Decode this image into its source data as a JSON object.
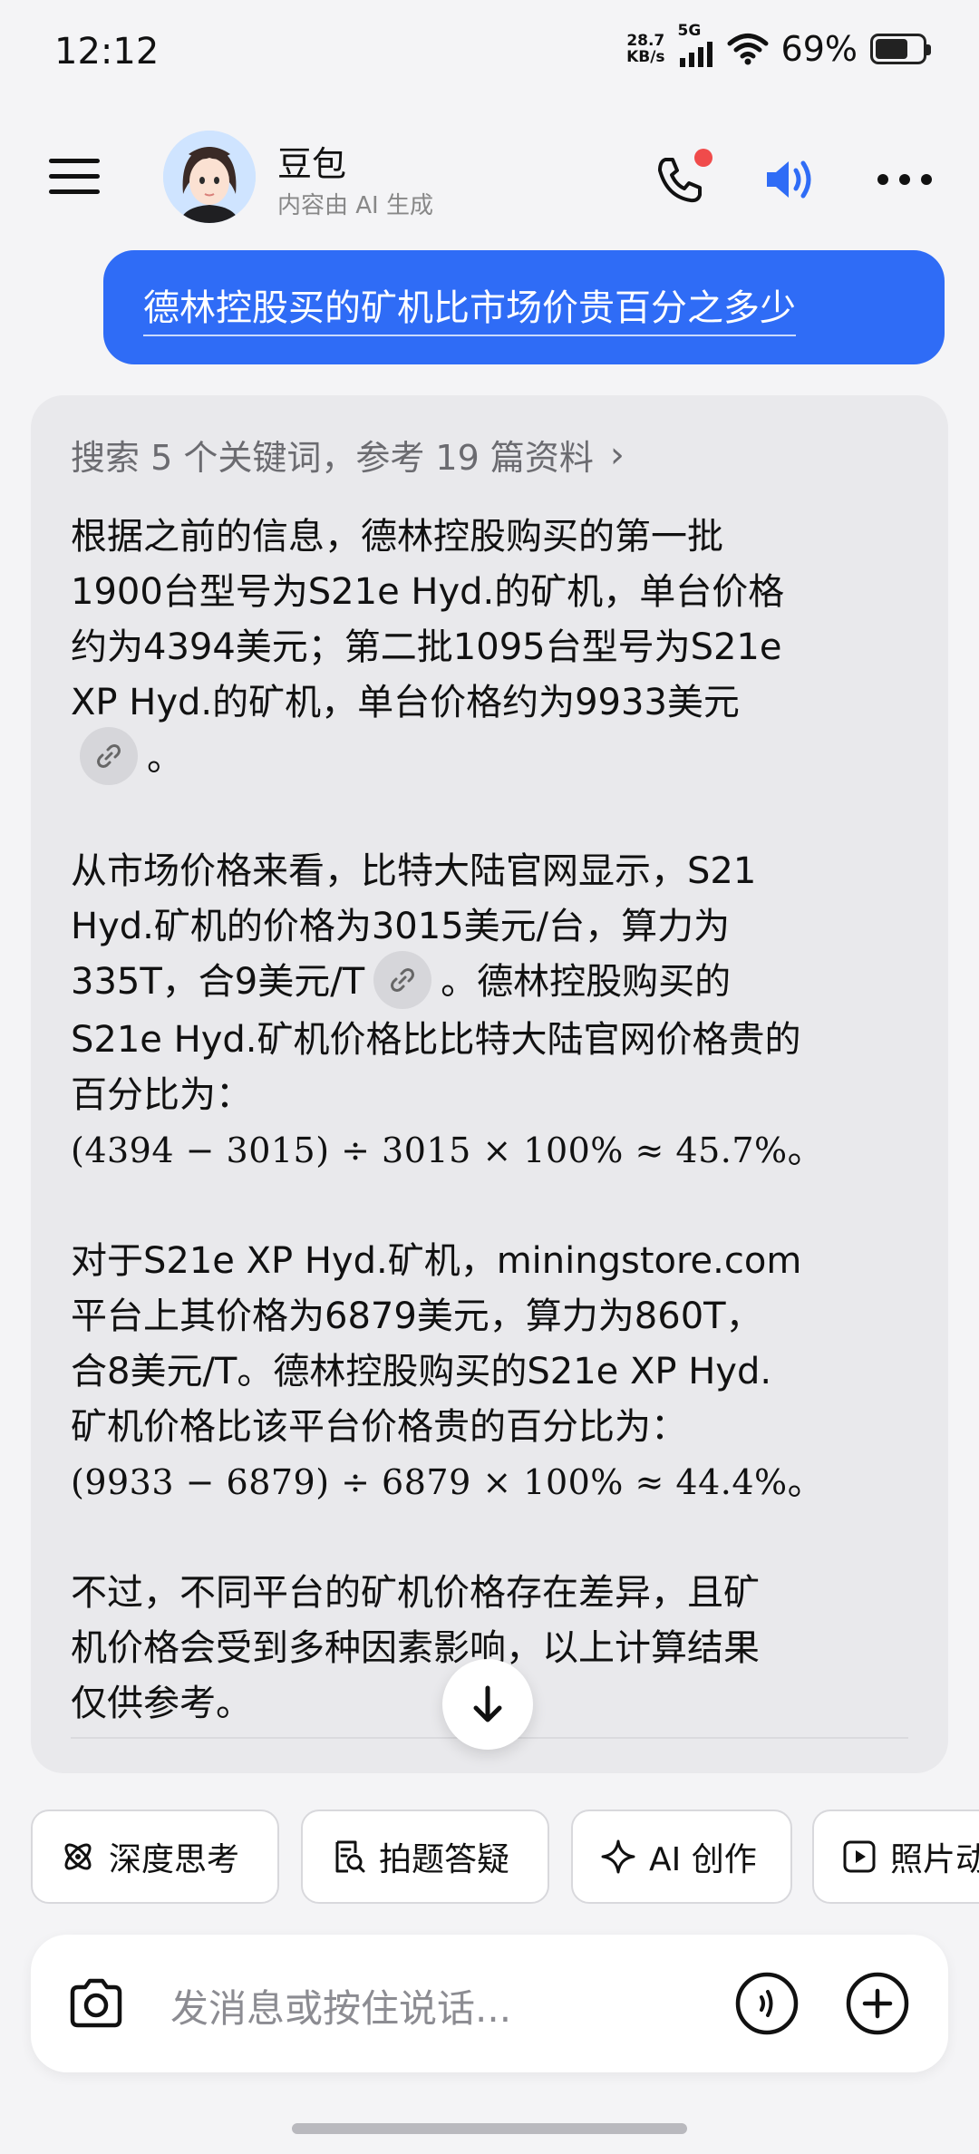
{
  "status": {
    "time": "12:12",
    "net_speed_value": "28.7",
    "net_speed_unit": "KB/s",
    "network": "5G",
    "battery_pct": "69%",
    "battery_level": 0.69
  },
  "header": {
    "bot_name": "豆包",
    "bot_subtitle": "内容由 AI 生成"
  },
  "user_message": "德林控股买的矿机比市场价贵百分之多少",
  "answer": {
    "search_summary": "搜索 5 个关键词，参考 19 篇资料",
    "p1_lines": [
      "根据之前的信息，德林控股购买的第一批",
      "1900台型号为S21e Hyd.的矿机，单台价格",
      "约为4394美元；第二批1095台型号为S21e",
      "XP Hyd.的矿机，单台价格约为9933美元"
    ],
    "p1_end": "。",
    "p2_lines": [
      "从市场价格来看，比特大陆官网显示，S21",
      "Hyd.矿机的价格为3015美元/台，算力为"
    ],
    "p2_line3_a": "335T，合9美元/T",
    "p2_line3_b": "。德林控股购买的",
    "p2_lines_after": [
      "S21e Hyd.矿机价格比比特大陆官网价格贵的",
      "百分比为："
    ],
    "p2_formula": "(4394 − 3015) ÷ 3015 × 100% ≈ 45.7%",
    "p2_formula_end": "。",
    "p3_lines": [
      "对于S21e XP Hyd.矿机，miningstore.com",
      "平台上其价格为6879美元，算力为860T，",
      "合8美元/T。德林控股购买的S21e XP Hyd.",
      "矿机价格比该平台价格贵的百分比为："
    ],
    "p3_formula": "(9933 − 6879) ÷ 6879 × 100% ≈ 44.4%",
    "p3_formula_end": "。",
    "p4_lines": [
      "不过，不同平台的矿机价格存在差异，且矿",
      "机价格会受到多种因素影响，以上计算结果",
      "仅供参考。"
    ]
  },
  "chips": [
    "深度思考",
    "拍题答疑",
    "AI 创作",
    "照片动"
  ],
  "input": {
    "placeholder": "发消息或按住说话..."
  },
  "icons": {
    "menu": "hamburger-icon",
    "phone": "phone-icon",
    "speaker": "speaker-icon",
    "more": "more-dots-icon",
    "cite": "link-icon",
    "scroll": "arrow-down-icon",
    "camera": "camera-icon",
    "voice": "voice-wave-icon",
    "plus": "plus-icon"
  },
  "colors": {
    "accent": "#2f6cf6",
    "notification_dot": "#f04b4b"
  }
}
